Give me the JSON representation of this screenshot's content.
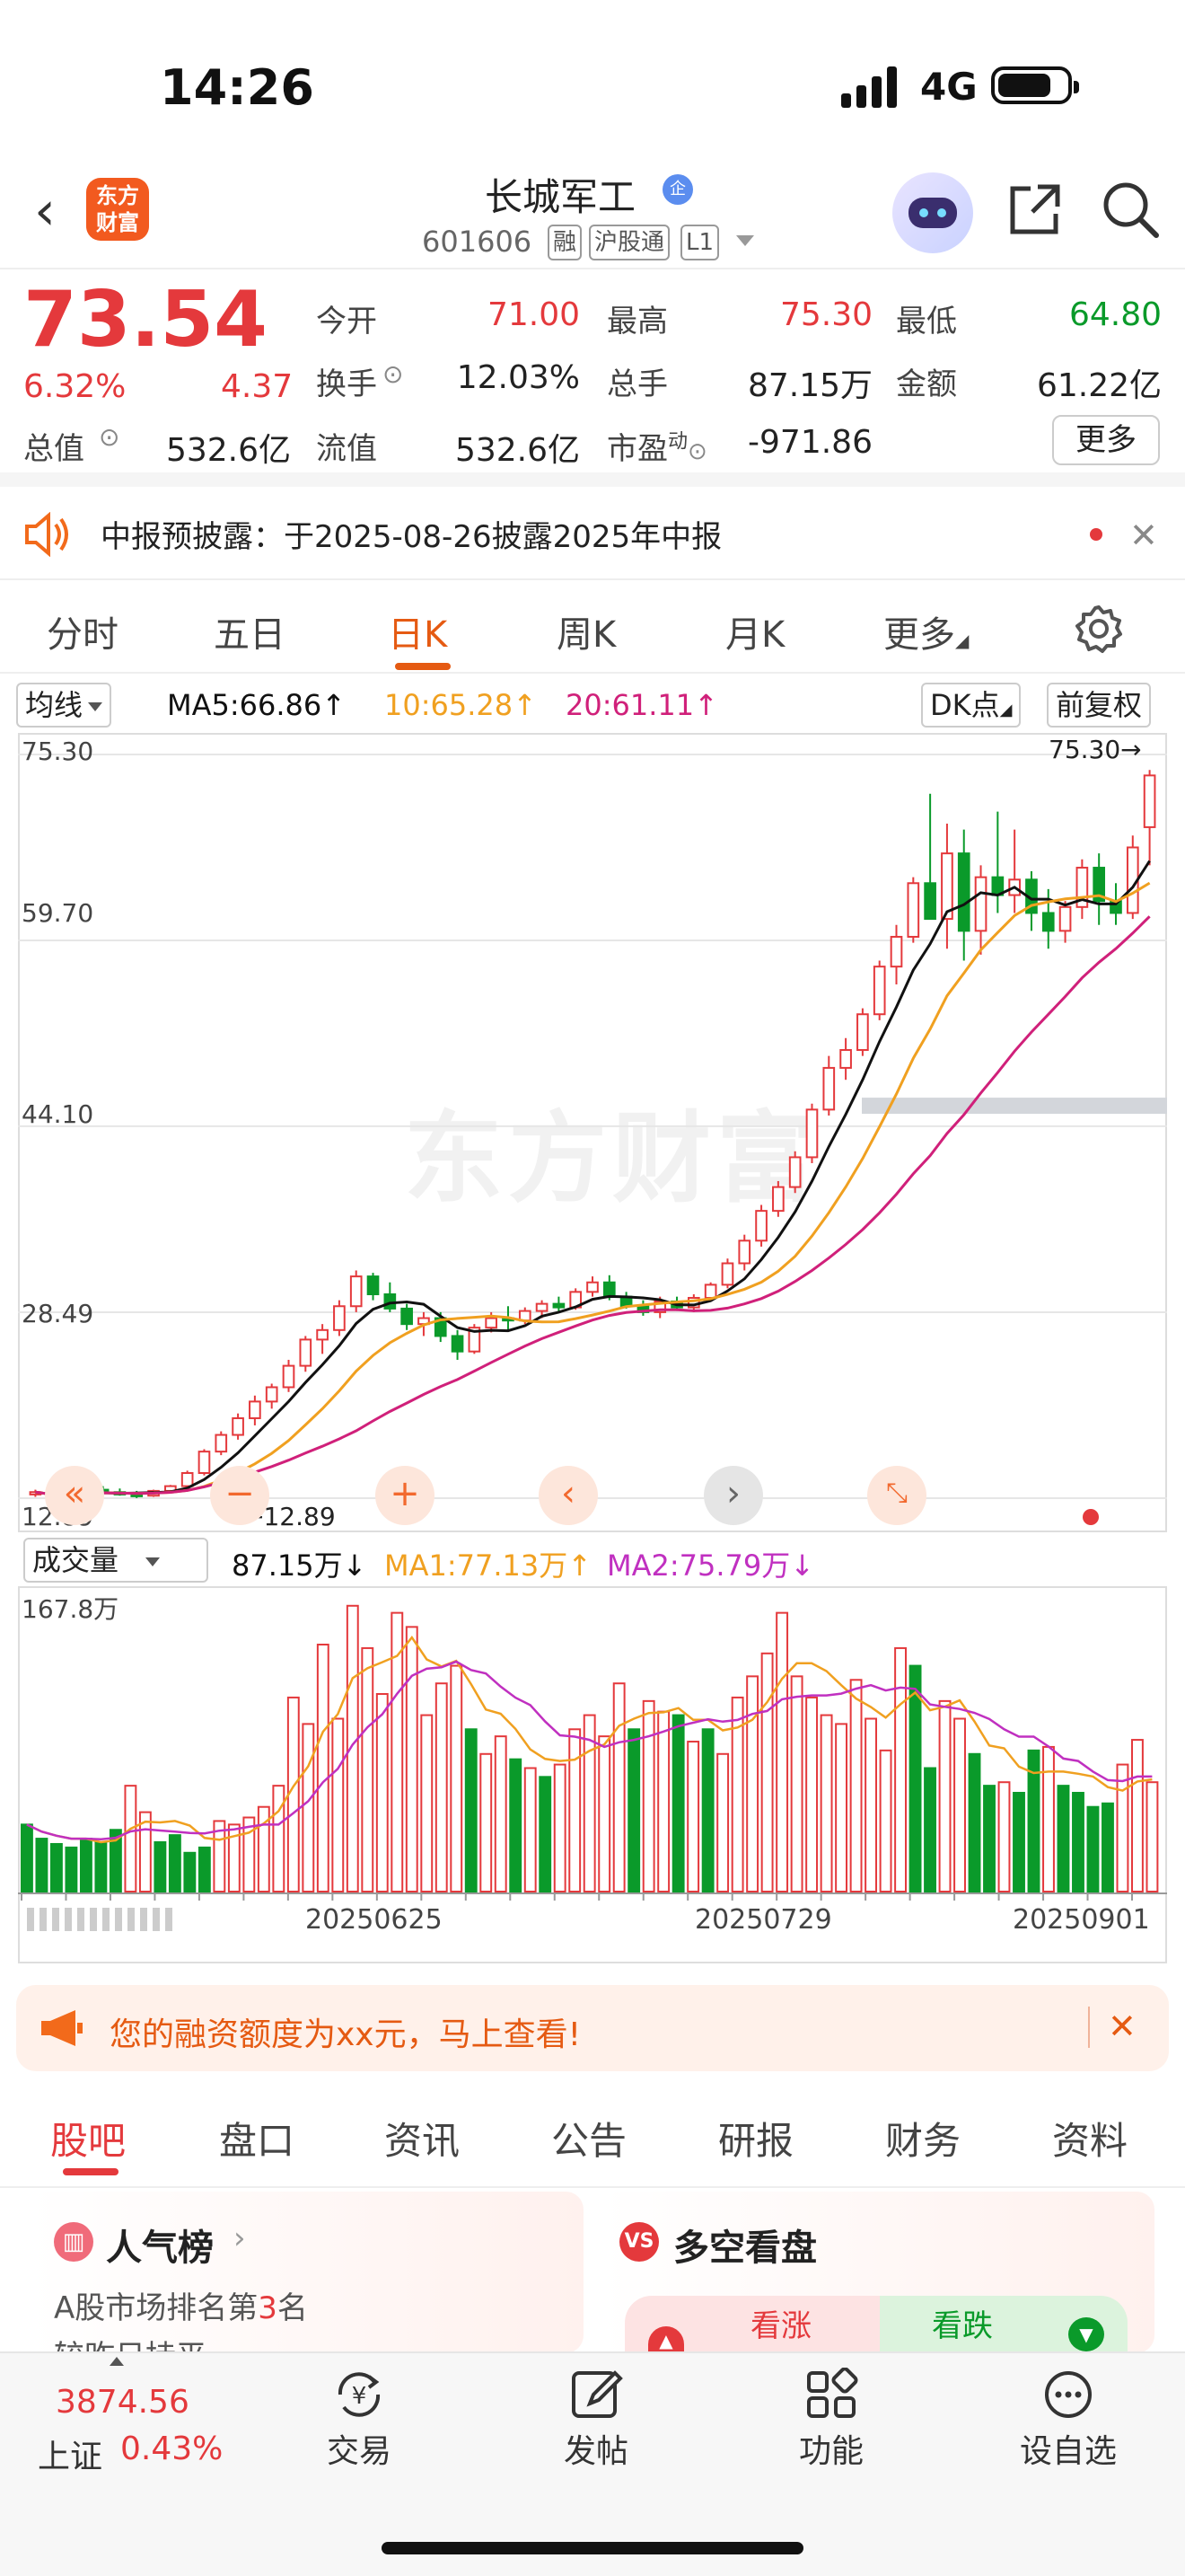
{
  "status_bar": {
    "time": "14:26",
    "network": "4G"
  },
  "header": {
    "logo_line1": "东方",
    "logo_line2": "财富",
    "stock_name": "长城军工",
    "badge": "企",
    "stock_code": "601606",
    "tags": [
      "融",
      "沪股通",
      "L1"
    ]
  },
  "quote": {
    "price": "73.54",
    "change_pct": "6.32%",
    "change": "4.37",
    "fields": [
      {
        "label": "今开",
        "value": "71.00",
        "color": "#e4393c"
      },
      {
        "label": "最高",
        "value": "75.30",
        "color": "#e4393c"
      },
      {
        "label": "最低",
        "value": "64.80",
        "color": "#0a9a2a"
      },
      {
        "label": "换手",
        "value": "12.03%",
        "color": "#222222"
      },
      {
        "label": "总手",
        "value": "87.15万",
        "color": "#222222"
      },
      {
        "label": "金额",
        "value": "61.22亿",
        "color": "#222222"
      },
      {
        "label": "总值",
        "value": "532.6亿",
        "color": "#222222"
      },
      {
        "label": "流值",
        "value": "532.6亿",
        "color": "#222222"
      },
      {
        "label": "市盈",
        "label_sup": "动",
        "value": "-971.86",
        "color": "#222222"
      }
    ],
    "more_label": "更多"
  },
  "notice": {
    "text": "中报预披露：于2025-08-26披露2025年中报"
  },
  "period_tabs": [
    "分时",
    "五日",
    "日K",
    "周K",
    "月K",
    "更多"
  ],
  "active_period": "日K",
  "ma_bar": {
    "selector": "均线",
    "ma5": "MA5:66.86",
    "ma10": "10:65.28",
    "ma20": "20:61.11",
    "dk_label": "DK点",
    "adjust_label": "前复权"
  },
  "watermark": "东方财富",
  "chart_data": {
    "type": "candlestick",
    "y_ticks": [
      "75.30",
      "59.70",
      "44.10",
      "28.49",
      "12.89"
    ],
    "ylim": [
      12.89,
      75.3
    ],
    "max_marker": "75.30",
    "min_marker": "12.89",
    "candles": [
      [
        13.2,
        13.6,
        13.0,
        13.4
      ],
      [
        13.4,
        13.5,
        12.9,
        13.0
      ],
      [
        13.0,
        13.4,
        12.9,
        13.3
      ],
      [
        13.3,
        13.8,
        13.2,
        13.6
      ],
      [
        13.6,
        13.9,
        13.3,
        13.4
      ],
      [
        13.4,
        13.7,
        13.1,
        13.2
      ],
      [
        13.2,
        13.5,
        12.9,
        13.1
      ],
      [
        13.1,
        13.6,
        13.0,
        13.5
      ],
      [
        13.5,
        14.0,
        13.4,
        13.9
      ],
      [
        13.9,
        15.2,
        13.8,
        15.0
      ],
      [
        15.0,
        17.0,
        14.8,
        16.8
      ],
      [
        16.8,
        18.5,
        16.5,
        18.2
      ],
      [
        18.2,
        20.0,
        17.8,
        19.6
      ],
      [
        19.6,
        21.5,
        19.0,
        21.0
      ],
      [
        21.0,
        22.5,
        20.4,
        22.2
      ],
      [
        22.2,
        24.5,
        21.8,
        24.0
      ],
      [
        24.0,
        26.5,
        23.5,
        26.2
      ],
      [
        26.2,
        27.5,
        25.0,
        27.0
      ],
      [
        27.0,
        29.5,
        26.5,
        29.0
      ],
      [
        29.0,
        32.0,
        28.5,
        31.5
      ],
      [
        31.5,
        31.8,
        29.5,
        30.0
      ],
      [
        30.0,
        31.0,
        28.5,
        28.8
      ],
      [
        28.8,
        29.2,
        27.0,
        27.5
      ],
      [
        27.5,
        28.5,
        26.5,
        28.0
      ],
      [
        28.0,
        28.5,
        26.0,
        26.5
      ],
      [
        26.5,
        27.0,
        24.5,
        25.2
      ],
      [
        25.2,
        27.5,
        25.0,
        27.2
      ],
      [
        27.2,
        28.5,
        26.8,
        28.0
      ],
      [
        28.0,
        29.0,
        27.0,
        27.8
      ],
      [
        27.8,
        28.9,
        27.5,
        28.6
      ],
      [
        28.6,
        29.5,
        28.0,
        29.2
      ],
      [
        29.2,
        29.8,
        28.5,
        28.9
      ],
      [
        28.9,
        30.5,
        28.7,
        30.2
      ],
      [
        30.2,
        31.5,
        29.8,
        31.0
      ],
      [
        31.0,
        31.6,
        29.5,
        29.8
      ],
      [
        29.8,
        30.2,
        28.8,
        29.0
      ],
      [
        29.0,
        29.5,
        28.2,
        28.5
      ],
      [
        28.5,
        29.8,
        28.0,
        29.4
      ],
      [
        29.4,
        29.8,
        28.6,
        28.9
      ],
      [
        28.9,
        30.0,
        28.5,
        29.7
      ],
      [
        29.7,
        31.0,
        29.5,
        30.8
      ],
      [
        30.8,
        33.0,
        30.5,
        32.6
      ],
      [
        32.6,
        35.0,
        32.0,
        34.5
      ],
      [
        34.5,
        37.5,
        34.0,
        37.0
      ],
      [
        37.0,
        39.5,
        36.5,
        39.0
      ],
      [
        39.0,
        42.0,
        38.5,
        41.5
      ],
      [
        41.5,
        46.0,
        41.0,
        45.5
      ],
      [
        45.5,
        50.0,
        45.0,
        49.0
      ],
      [
        49.0,
        51.5,
        48.0,
        50.5
      ],
      [
        50.5,
        54.0,
        50.0,
        53.5
      ],
      [
        53.5,
        58.0,
        53.0,
        57.5
      ],
      [
        57.5,
        61.0,
        56.0,
        60.0
      ],
      [
        60.0,
        65.0,
        59.5,
        64.5
      ],
      [
        64.5,
        72.0,
        63.5,
        61.5
      ],
      [
        61.5,
        69.5,
        59.0,
        67.0
      ],
      [
        67.0,
        69.0,
        58.0,
        60.5
      ],
      [
        60.5,
        66.0,
        58.5,
        65.0
      ],
      [
        65.0,
        70.5,
        62.0,
        63.5
      ],
      [
        63.5,
        69.0,
        62.0,
        64.8
      ],
      [
        64.8,
        65.5,
        60.5,
        62.0
      ],
      [
        62.0,
        64.0,
        59.0,
        60.5
      ],
      [
        60.5,
        63.0,
        59.5,
        62.5
      ],
      [
        62.5,
        66.5,
        61.5,
        65.8
      ],
      [
        65.8,
        67.0,
        61.0,
        63.0
      ],
      [
        63.0,
        64.5,
        61.0,
        62.0
      ],
      [
        62.0,
        68.5,
        61.5,
        67.5
      ],
      [
        69.2,
        74.0,
        66.0,
        73.54
      ]
    ],
    "ma_colors": {
      "ma5": "#111111",
      "ma10": "#f0a020",
      "ma20": "#d0207a"
    }
  },
  "volume": {
    "selector": "成交量",
    "value": "87.15万",
    "ma1": "MA1:77.13万",
    "ma2": "MA2:75.79万",
    "max_label": "167.8万",
    "dates": [
      "20250625",
      "20250729",
      "20250901"
    ],
    "bars": [
      38,
      30,
      27,
      25,
      30,
      28,
      35,
      60,
      45,
      28,
      32,
      22,
      25,
      40,
      38,
      42,
      48,
      60,
      110,
      95,
      140,
      98,
      162,
      138,
      112,
      158,
      150,
      100,
      118,
      128,
      92,
      78,
      88,
      75,
      70,
      65,
      72,
      92,
      100,
      88,
      118,
      92,
      108,
      102,
      100,
      85,
      92,
      78,
      110,
      122,
      135,
      158,
      122,
      110,
      100,
      95,
      120,
      98,
      80,
      138,
      128,
      70,
      108,
      98,
      78,
      60,
      62,
      56,
      80,
      82,
      60,
      56,
      48,
      50,
      72,
      86,
      62
    ],
    "bar_colors": [
      "g",
      "g",
      "g",
      "g",
      "g",
      "g",
      "g",
      "r",
      "r",
      "g",
      "g",
      "g",
      "g",
      "r",
      "r",
      "r",
      "r",
      "r",
      "r",
      "r",
      "r",
      "r",
      "r",
      "r",
      "r",
      "r",
      "r",
      "r",
      "r",
      "r",
      "g",
      "r",
      "r",
      "g",
      "r",
      "g",
      "r",
      "r",
      "r",
      "r",
      "r",
      "g",
      "r",
      "r",
      "g",
      "r",
      "g",
      "r",
      "r",
      "r",
      "r",
      "r",
      "r",
      "r",
      "r",
      "r",
      "r",
      "r",
      "r",
      "r",
      "g",
      "g",
      "r",
      "r",
      "g",
      "g",
      "r",
      "g",
      "g",
      "r",
      "g",
      "g",
      "g",
      "g",
      "r",
      "r",
      "r"
    ]
  },
  "promo": {
    "text": "您的融资额度为xx元，马上查看!"
  },
  "sub_tabs": [
    "股吧",
    "盘口",
    "资讯",
    "公告",
    "研报",
    "财务",
    "资料"
  ],
  "active_sub_tab": "股吧",
  "cards": {
    "popularity": {
      "title": "人气榜",
      "line1_a": "A股市场排名第",
      "line1_b": "3",
      "line1_c": "名",
      "line2": "较昨日持平"
    },
    "sentiment": {
      "title": "多空看盘",
      "bull": "看涨",
      "bear": "看跌"
    }
  },
  "bottom_bar": {
    "index_value": "3874.56",
    "index_name": "上证",
    "index_pct": "0.43%",
    "items": [
      {
        "label": "交易",
        "icon": "yen-cycle-icon"
      },
      {
        "label": "发帖",
        "icon": "edit-icon"
      },
      {
        "label": "功能",
        "icon": "grid-icon"
      },
      {
        "label": "设自选",
        "icon": "more-dots-icon"
      }
    ]
  }
}
